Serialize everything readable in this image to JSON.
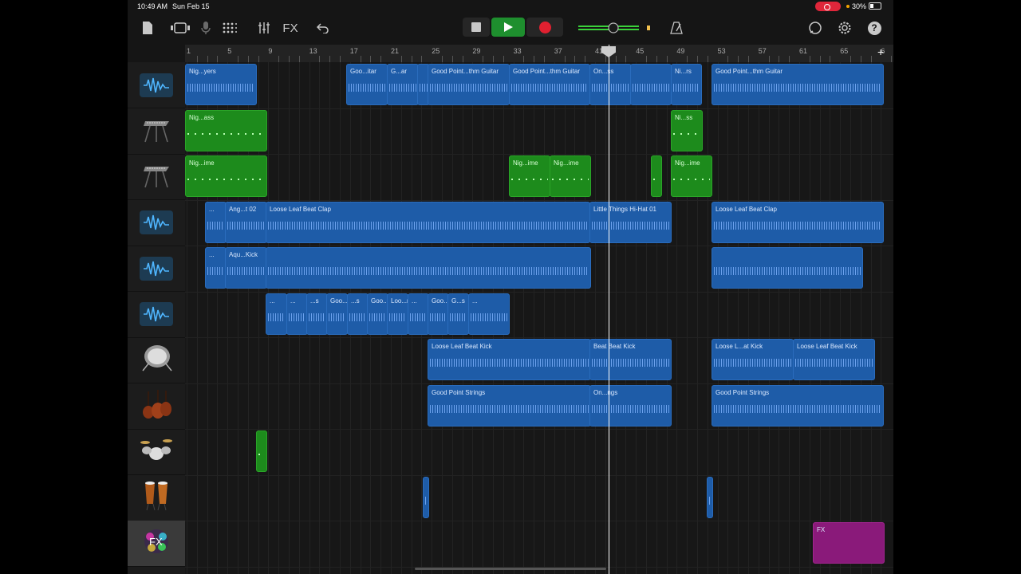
{
  "status": {
    "time": "10:49 AM",
    "date": "Sun Feb 15",
    "battery": "30%"
  },
  "toolbar": {
    "fx_label": "FX",
    "icons": [
      "document-icon",
      "view-toggle-icon",
      "microphone-icon",
      "grid-icon",
      "mixer-icon",
      "undo-icon",
      "stop-icon",
      "play-icon",
      "record-icon",
      "volume-slider",
      "metronome-icon",
      "loop-icon",
      "settings-icon",
      "help-icon"
    ],
    "colors": {
      "play": "#1e8f2e",
      "record": "#e02030",
      "accent": "#3ad13a"
    }
  },
  "ruler": {
    "bars": [
      "1",
      "5",
      "9",
      "13",
      "17",
      "21",
      "25",
      "29",
      "33",
      "37",
      "41",
      "45",
      "49",
      "53",
      "57",
      "61",
      "65",
      "6"
    ]
  },
  "tracks": [
    {
      "icon": "waveform-icon",
      "regions": [
        {
          "color": "blue",
          "label": "Nig...yers"
        },
        {
          "color": "blue",
          "label": "Goo...itar"
        },
        {
          "color": "blue",
          "label": "G...ar"
        },
        {
          "color": "blue",
          "label": ""
        },
        {
          "color": "blue",
          "label": "Good Point...thm Guitar"
        },
        {
          "color": "blue",
          "label": "Good Point...thm Guitar"
        },
        {
          "color": "blue",
          "label": "On...ss"
        },
        {
          "color": "blue",
          "label": ""
        },
        {
          "color": "blue",
          "label": "Ni...rs"
        },
        {
          "color": "blue",
          "label": "Good Point...thm Guitar"
        }
      ]
    },
    {
      "icon": "keyboard-icon",
      "regions": [
        {
          "color": "green",
          "label": "Nig...ass"
        },
        {
          "color": "green",
          "label": "Ni...ss"
        }
      ]
    },
    {
      "icon": "keyboard-icon",
      "regions": [
        {
          "color": "green",
          "label": "Nig...ime"
        },
        {
          "color": "green",
          "label": "Nig...ime"
        },
        {
          "color": "green",
          "label": "Nig...ime"
        },
        {
          "color": "green",
          "label": ""
        },
        {
          "color": "green",
          "label": "Nig...ime"
        }
      ]
    },
    {
      "icon": "waveform-icon",
      "regions": [
        {
          "color": "blue",
          "label": "..."
        },
        {
          "color": "blue",
          "label": "Ang...t 02"
        },
        {
          "color": "blue",
          "label": "Loose Leaf Beat Clap"
        },
        {
          "color": "blue",
          "label": "Little Things Hi-Hat 01"
        },
        {
          "color": "blue",
          "label": "Loose Leaf Beat Clap"
        }
      ]
    },
    {
      "icon": "waveform-icon",
      "regions": [
        {
          "color": "blue",
          "label": "..."
        },
        {
          "color": "blue",
          "label": "Aqu...Kick"
        },
        {
          "color": "blue",
          "label": ""
        },
        {
          "color": "blue",
          "label": ""
        }
      ]
    },
    {
      "icon": "waveform-icon",
      "regions": [
        {
          "color": "blue",
          "label": "..."
        },
        {
          "color": "blue",
          "label": "..."
        },
        {
          "color": "blue",
          "label": "...s"
        },
        {
          "color": "blue",
          "label": "Goo...ass"
        },
        {
          "color": "blue",
          "label": "...s"
        },
        {
          "color": "blue",
          "label": "Goo...ass"
        },
        {
          "color": "blue",
          "label": "Loo...rash"
        },
        {
          "color": "blue",
          "label": "..."
        },
        {
          "color": "blue",
          "label": "Goo...ass"
        },
        {
          "color": "blue",
          "label": "G...s"
        },
        {
          "color": "blue",
          "label": "..."
        }
      ]
    },
    {
      "icon": "drum-icon",
      "regions": [
        {
          "color": "blue",
          "label": "Loose Leaf Beat Kick"
        },
        {
          "color": "blue",
          "label": "Beat Beat Kick"
        },
        {
          "color": "blue",
          "label": "Loose L...at Kick"
        },
        {
          "color": "blue",
          "label": "Loose Leaf Beat Kick"
        }
      ]
    },
    {
      "icon": "strings-icon",
      "regions": [
        {
          "color": "blue",
          "label": "Good Point Strings"
        },
        {
          "color": "blue",
          "label": "On...ngs"
        },
        {
          "color": "blue",
          "label": "Good Point Strings"
        }
      ]
    },
    {
      "icon": "drumkit-icon",
      "regions": [
        {
          "color": "green",
          "label": ""
        }
      ]
    },
    {
      "icon": "conga-icon",
      "regions": [
        {
          "color": "blue",
          "label": ""
        },
        {
          "color": "blue",
          "label": ""
        }
      ]
    },
    {
      "icon": "fx-icon",
      "regions": [
        {
          "color": "purple",
          "label": "FX"
        }
      ]
    }
  ]
}
